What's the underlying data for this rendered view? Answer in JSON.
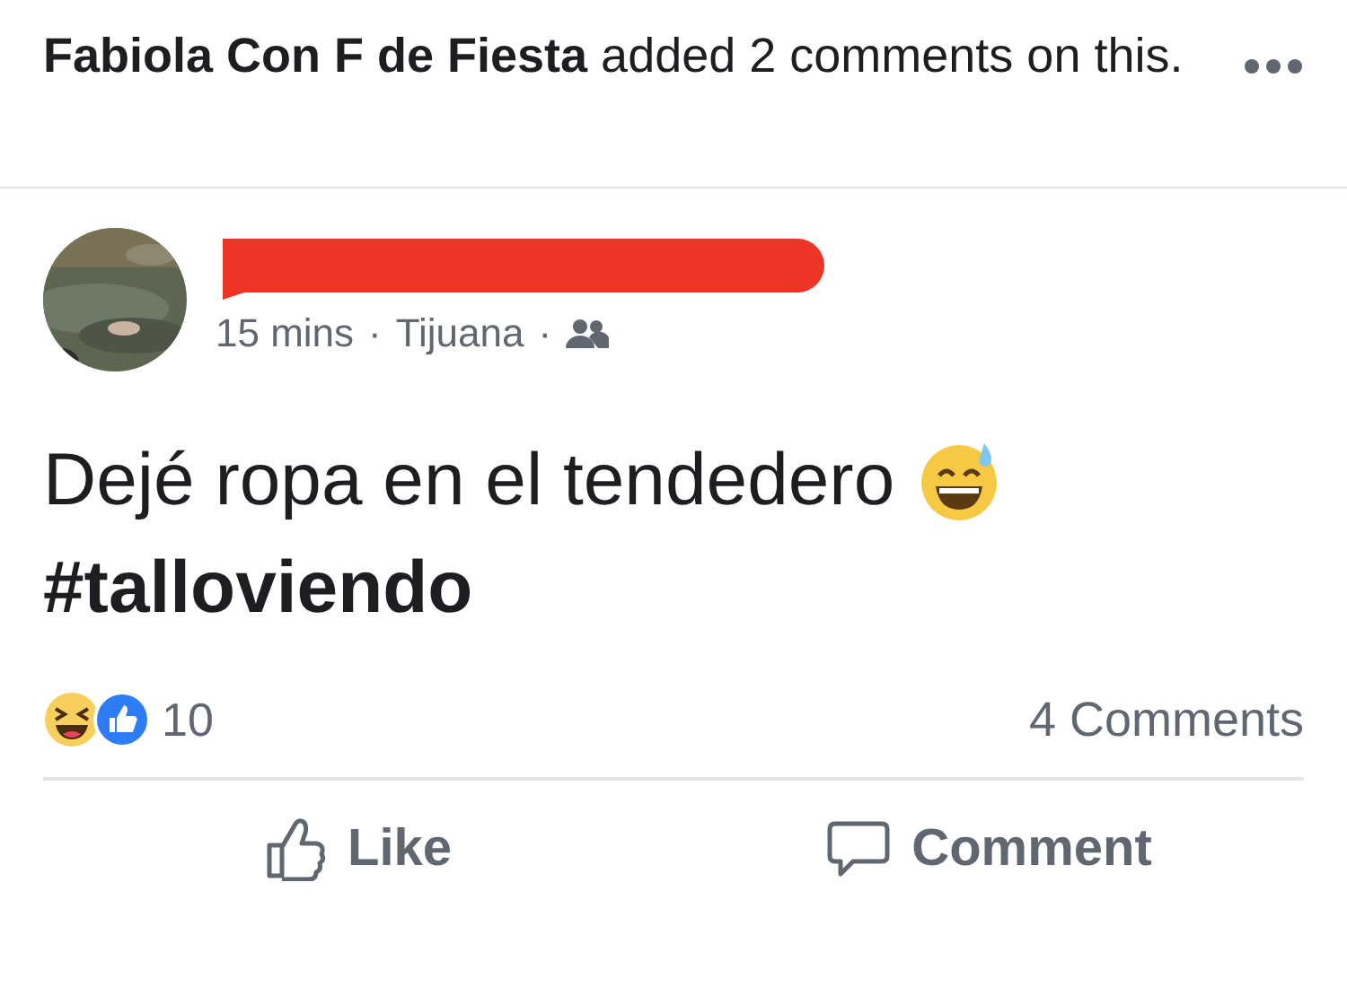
{
  "story": {
    "actor": "Fabiola Con F de Fiesta",
    "action": "added 2 comments on this."
  },
  "post": {
    "time": "15 mins",
    "location": "Tijuana",
    "separator": "·",
    "text": "Dejé ropa en el tendedero",
    "hashtag": "#talloviendo"
  },
  "reactions": {
    "count": "10",
    "comments": "4 Comments"
  },
  "actions": [
    {
      "label": "Like",
      "kind": "like"
    },
    {
      "label": "Comment",
      "kind": "comment"
    }
  ]
}
